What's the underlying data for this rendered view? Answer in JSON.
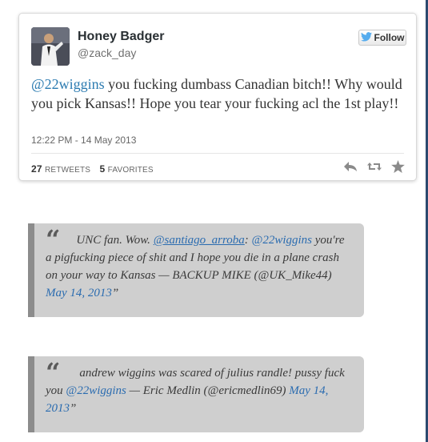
{
  "tweet": {
    "name": "Honey Badger",
    "handle": "@zack_day",
    "follow_label": "Follow",
    "mention": "@22wiggins",
    "text": " you fucking dumbass Canadian bitch!! Why would you pick Kansas!! Hope you tear your fucking acl the 1st play!!",
    "timestamp": "12:22 PM - 14 May 2013",
    "retweets_count": "27",
    "retweets_label": "Retweets",
    "favorites_count": "5",
    "favorites_label": "Favorites"
  },
  "quotes": [
    {
      "open_mark": "“",
      "part1": "UNC fan. Wow. ",
      "link1": "@santiago_arroba",
      "part2": ": ",
      "link2": "@22wiggins",
      "part3": " you're a pigfucking piece of shit and I hope you die in a plane crash on your way to Kansas — BACKUP MIKE (@UK_Mike44) ",
      "date_link": "May 14, 2013",
      "close_mark": "”"
    },
    {
      "open_mark": "“",
      "part1": "andrew wiggins was scared of julius randle! pussy fuck you ",
      "link1": "@22wiggins",
      "part2": " — Eric Medlin (@ericmedlin69) ",
      "date_link": "May 14, 2013",
      "close_mark": "”"
    }
  ],
  "colors": {
    "link": "#2a7ab0",
    "quote_bg": "#cfcfcf",
    "quote_border": "#8c8c8c",
    "twitter_bird": "#55acee"
  },
  "icons": [
    "twitter-bird-icon",
    "reply-icon",
    "retweet-icon",
    "favorite-icon"
  ]
}
